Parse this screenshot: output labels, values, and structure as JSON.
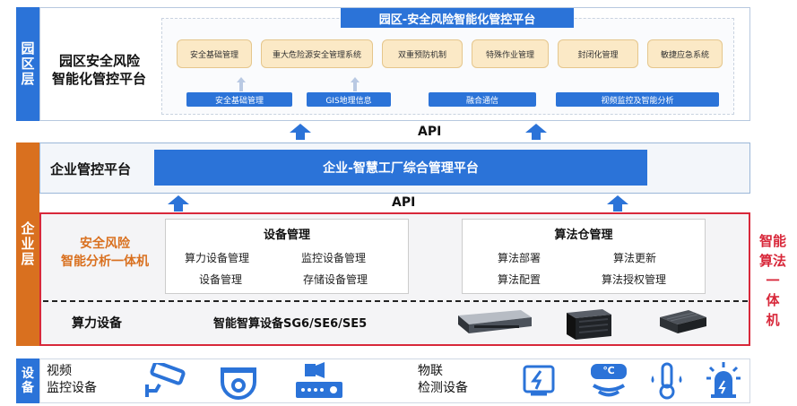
{
  "park_layer": {
    "side_label": [
      "园",
      "区",
      "层"
    ],
    "title_line1": "园区安全风险",
    "title_line2": "智能化管控平台",
    "platform_banner": "园区-安全风险智能化管控平台",
    "modules": [
      "安全基础管理",
      "重大危险源安全管理系统",
      "双重预防机制",
      "特殊作业管理",
      "封闭化管理",
      "敏捷应急系统"
    ],
    "services": [
      "安全基础管理",
      "GIS地理信息",
      "融合通信",
      "视频监控及智能分析"
    ]
  },
  "api_top": "API",
  "enterprise_layer": {
    "side_label": [
      "企",
      "业",
      "层"
    ],
    "control_title": "企业管控平台",
    "control_bar": "企业-智慧工厂综合管理平台",
    "api_mid": "API",
    "machine_title_line1": "安全风险",
    "machine_title_line2": "智能分析一体机",
    "device_mgmt": {
      "title": "设备管理",
      "items": [
        "算力设备管理",
        "监控设备管理",
        "设备管理",
        "存储设备管理"
      ]
    },
    "algo_mgmt": {
      "title": "算法仓管理",
      "items": [
        "算法部署",
        "算法更新",
        "算法配置",
        "算法授权管理"
      ]
    },
    "compute_title": "算力设备",
    "compute_models": "智能智算设备SG6/SE6/SE5",
    "right_label": [
      "智能",
      "算法",
      "一",
      "体",
      "机"
    ]
  },
  "device_layer": {
    "side_label": [
      "设",
      "备"
    ],
    "video_line1": "视频",
    "video_line2": "监控设备",
    "iot_line1": "物联",
    "iot_line2": "检测设备",
    "temp_symbol": "℃"
  },
  "colors": {
    "park_blue": "#2b73d8",
    "enterprise_orange": "#d9701f",
    "red_border": "#d8283a",
    "module_fill": "#fbe9c6"
  }
}
